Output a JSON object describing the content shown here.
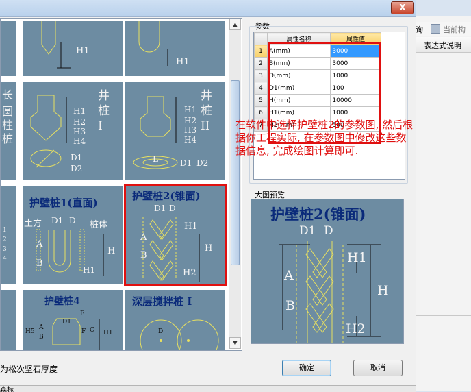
{
  "dialog": {
    "close_label": "X",
    "params_label": "参数",
    "preview_label": "大图预览",
    "ok_label": "确定",
    "cancel_label": "取消",
    "bottom_left_text": "为松次坚石厚度",
    "bottom_corner_text": "森标"
  },
  "table": {
    "col_name": "属性名称",
    "col_value": "属性值",
    "rows": [
      {
        "n": "1",
        "name": "A(mm)",
        "value": "3000"
      },
      {
        "n": "2",
        "name": "B(mm)",
        "value": "3000"
      },
      {
        "n": "3",
        "name": "D(mm)",
        "value": "1000"
      },
      {
        "n": "4",
        "name": "D1(mm)",
        "value": "100"
      },
      {
        "n": "5",
        "name": "H(mm)",
        "value": "10000"
      },
      {
        "n": "6",
        "name": "H1(mm)",
        "value": "1000"
      },
      {
        "n": "7",
        "name": "H2(mm)",
        "value": "500"
      }
    ]
  },
  "thumbs": {
    "t1_label": "H1",
    "t2_label": "H1",
    "t3_title_lines": [
      "长",
      "圆",
      "柱",
      "桩"
    ],
    "t4_title": "井\n桩\nI",
    "t4_labels": [
      "H1",
      "H2",
      "H3",
      "H4",
      "D1",
      "D2"
    ],
    "t5_title": "井\n桩\nII",
    "t5_labels": [
      "H1",
      "H2",
      "H3",
      "H4",
      "L",
      "D1",
      "D2"
    ],
    "t6_labels": [
      "1",
      "2",
      "3",
      "4"
    ],
    "t7_title": "护壁桩1(直面)",
    "t7_labels": [
      "土方",
      "D1",
      "D",
      "桩体",
      "A",
      "B",
      "H",
      "H1"
    ],
    "t8_title": "护壁桩2(锥面)",
    "t8_labels": [
      "D1",
      "D",
      "H1",
      "A",
      "B",
      "H",
      "H2"
    ],
    "t9_title": "护壁桩4",
    "t9_labels": [
      "E",
      "D1",
      "H5",
      "A",
      "B",
      "F",
      "C",
      "H1"
    ],
    "t10_title": "深层搅拌桩 I",
    "t10_labels": [
      "D"
    ]
  },
  "preview": {
    "title": "护壁桩2(锥面)",
    "labels": {
      "d1": "D1",
      "d": "D",
      "h1": "H1",
      "a": "A",
      "b": "B",
      "h": "H",
      "h2": "H2"
    }
  },
  "annotation": {
    "lines": [
      "在软件中选择护壁桩2的参数图, 然后根",
      "据你工程实际, 在参数图中修改这些数",
      "据信息, 完成绘图计算即可."
    ]
  },
  "right_app": {
    "toolbar_items": [
      "询",
      "当前构"
    ],
    "column_header": "表达式说明"
  },
  "colors": {
    "highlight_red": "#e01010",
    "thumb_bg": "#6d8ca2",
    "title_blue": "#0a2a7a"
  }
}
